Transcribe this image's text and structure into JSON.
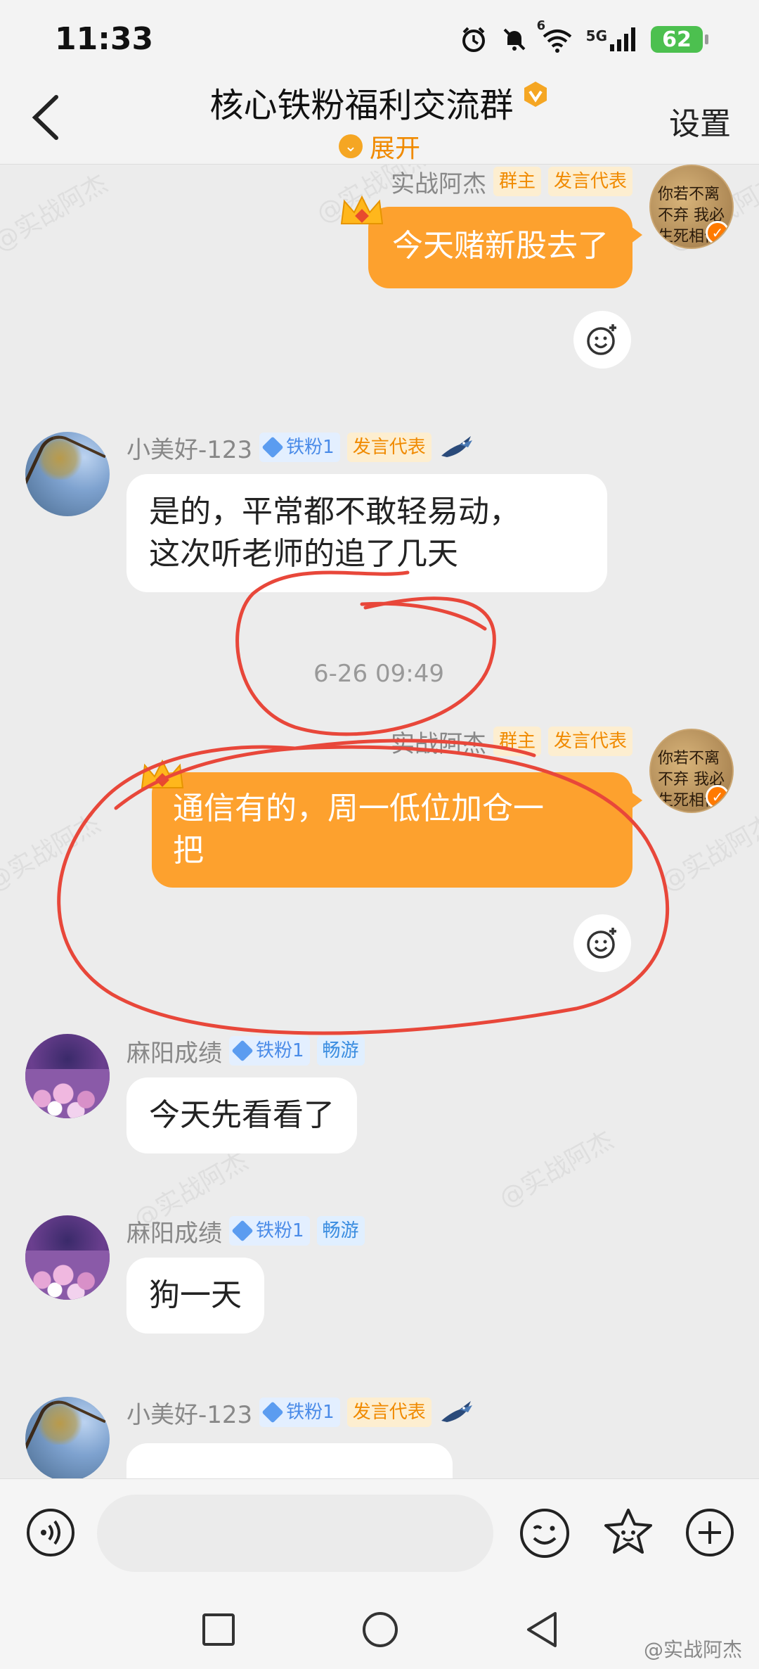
{
  "status_bar": {
    "time": "11:33",
    "battery": "62",
    "network": "5G",
    "wifi_sup": "6"
  },
  "header": {
    "title": "核心铁粉福利交流群",
    "expand_label": "展开",
    "settings_label": "设置"
  },
  "watermark_text": "@实战阿杰",
  "messages": [
    {
      "sender": "实战阿杰",
      "badges": [
        "群主",
        "发言代表"
      ],
      "text": "今天赌新股去了",
      "avatar_text": "你若不离不弃 我必生死相依"
    },
    {
      "sender": "小美好-123",
      "badges": [
        "铁粉1",
        "发言代表"
      ],
      "text_line1": "是的，平常都不敢轻易动，",
      "text_line2": "这次听老师的追了几天"
    },
    {
      "timestamp": "6-26 09:49"
    },
    {
      "sender": "实战阿杰",
      "badges": [
        "群主",
        "发言代表"
      ],
      "text_line1": "通信有的，周一低位加仓一",
      "text_line2": "把"
    },
    {
      "sender": "麻阳成绩",
      "badges": [
        "铁粉1",
        "畅游"
      ],
      "text": "今天先看看了"
    },
    {
      "sender": "麻阳成绩",
      "badges": [
        "铁粉1",
        "畅游"
      ],
      "text": "狗一天"
    },
    {
      "sender": "小美好-123",
      "badges": [
        "铁粉1",
        "发言代表"
      ],
      "text": ""
    }
  ],
  "input": {
    "placeholder": "",
    "value": ""
  },
  "corner_watermark": "@实战阿杰",
  "colors": {
    "accent": "#fda12e",
    "annotation": "#e8473a"
  },
  "icons": [
    "alarm-icon",
    "mute-icon",
    "wifi-icon",
    "signal-icon",
    "battery-icon",
    "back-icon",
    "verified-icon",
    "expand-icon",
    "crown-icon",
    "emoji-react-icon",
    "bird-icon",
    "voice-icon",
    "emoji-icon",
    "sticker-icon",
    "plus-icon"
  ]
}
